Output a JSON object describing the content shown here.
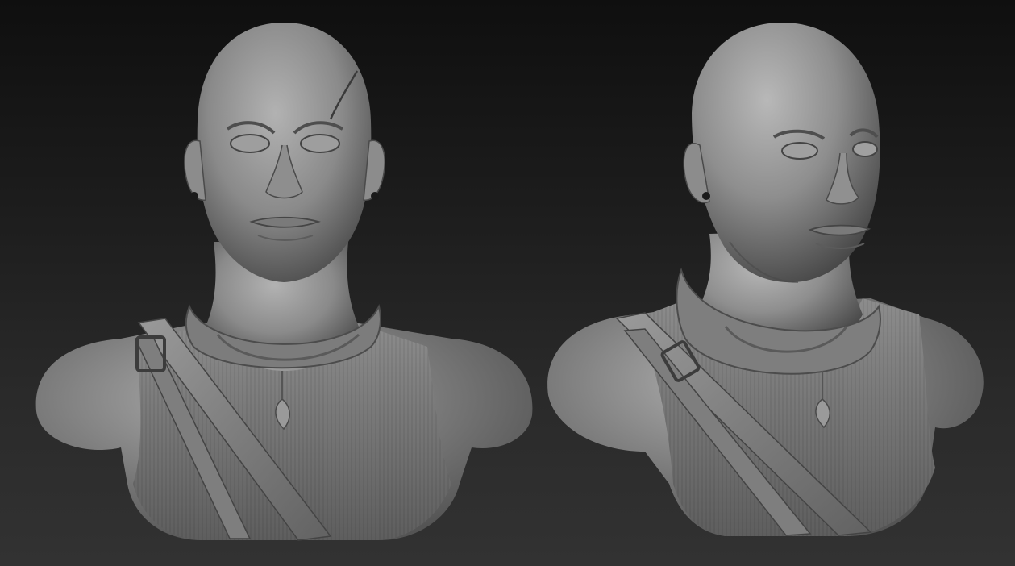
{
  "scene": {
    "background_top": "#0f0f0f",
    "background_bottom": "#323232",
    "clay_light": "#a8a8a8",
    "clay_mid": "#7a7a7a",
    "clay_dark": "#3e3e3e"
  },
  "views": [
    {
      "view": "front"
    },
    {
      "view": "three-quarter"
    }
  ]
}
